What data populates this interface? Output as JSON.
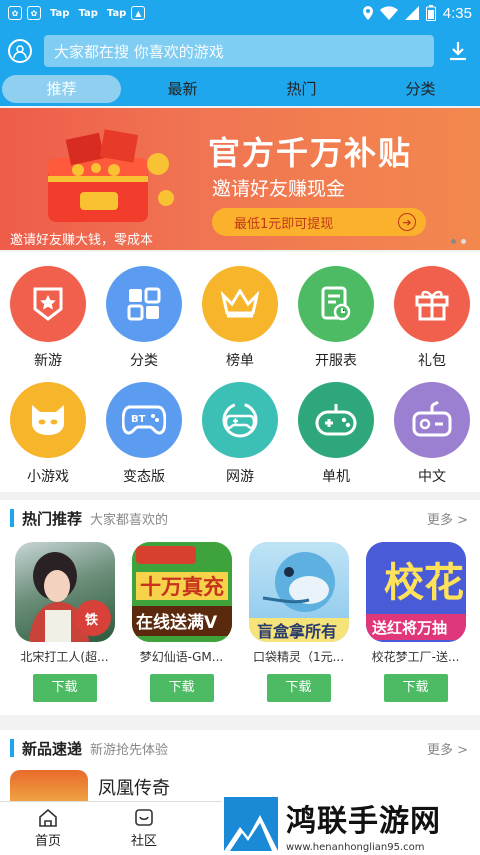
{
  "status_bar": {
    "tap_labels": [
      "Tap",
      "Tap",
      "Tap"
    ],
    "time": "4:35",
    "icons": [
      "baidu-paw-icon",
      "baidu-paw-icon",
      "image-icon",
      "location-icon",
      "wifi-icon",
      "signal-icon",
      "battery-icon"
    ]
  },
  "header": {
    "search_placeholder": "大家都在搜  你喜欢的游戏"
  },
  "tabs": [
    {
      "label": "推荐",
      "active": true
    },
    {
      "label": "最新",
      "active": false
    },
    {
      "label": "热门",
      "active": false
    },
    {
      "label": "分类",
      "active": false
    }
  ],
  "banner": {
    "title": "官方千万补贴",
    "subtitle": "邀请好友赚现金",
    "pill_text": "最低1元即可提现",
    "caption": "邀请好友赚大钱，零成本"
  },
  "categories": [
    {
      "label": "新游",
      "color": "#f0604c",
      "icon": "star-badge-icon"
    },
    {
      "label": "分类",
      "color": "#5b9cf0",
      "icon": "grid-icon"
    },
    {
      "label": "榜单",
      "color": "#f7b52c",
      "icon": "crown-icon"
    },
    {
      "label": "开服表",
      "color": "#4cbb64",
      "icon": "schedule-icon"
    },
    {
      "label": "礼包",
      "color": "#f0604c",
      "icon": "gift-icon"
    },
    {
      "label": "小游戏",
      "color": "#f7b52c",
      "icon": "cat-face-icon"
    },
    {
      "label": "变态版",
      "color": "#5b9cf0",
      "icon": "bt-gamepad-icon"
    },
    {
      "label": "网游",
      "color": "#3cbfb4",
      "icon": "online-gamepad-icon"
    },
    {
      "label": "单机",
      "color": "#2ea87a",
      "icon": "joystick-icon"
    },
    {
      "label": "中文",
      "color": "#9b7fd0",
      "icon": "controller-icon"
    }
  ],
  "hot": {
    "title": "热门推荐",
    "subtitle": "大家都喜欢的",
    "more": "更多 >",
    "apps": [
      {
        "name": "北宋打工人(超...",
        "download": "下载"
      },
      {
        "name": "梦幻仙语-GM...",
        "download": "下载"
      },
      {
        "name": "口袋精灵（1元...",
        "download": "下载"
      },
      {
        "name": "校花梦工厂-送...",
        "download": "下载"
      }
    ],
    "icon_texts": [
      "十万真充",
      "在线送满V",
      "盲盒拿所有",
      "校花",
      "送红将万抽"
    ]
  },
  "newest": {
    "title": "新品速递",
    "subtitle": "新游抢先体验",
    "more": "更多 >",
    "first_app": "凤凰传奇"
  },
  "bottom_nav": [
    {
      "label": "首页",
      "icon": "home-icon"
    },
    {
      "label": "社区",
      "icon": "community-icon"
    }
  ],
  "watermark": {
    "title": "鸿联手游网",
    "url": "www.henanhonglian95.com"
  }
}
